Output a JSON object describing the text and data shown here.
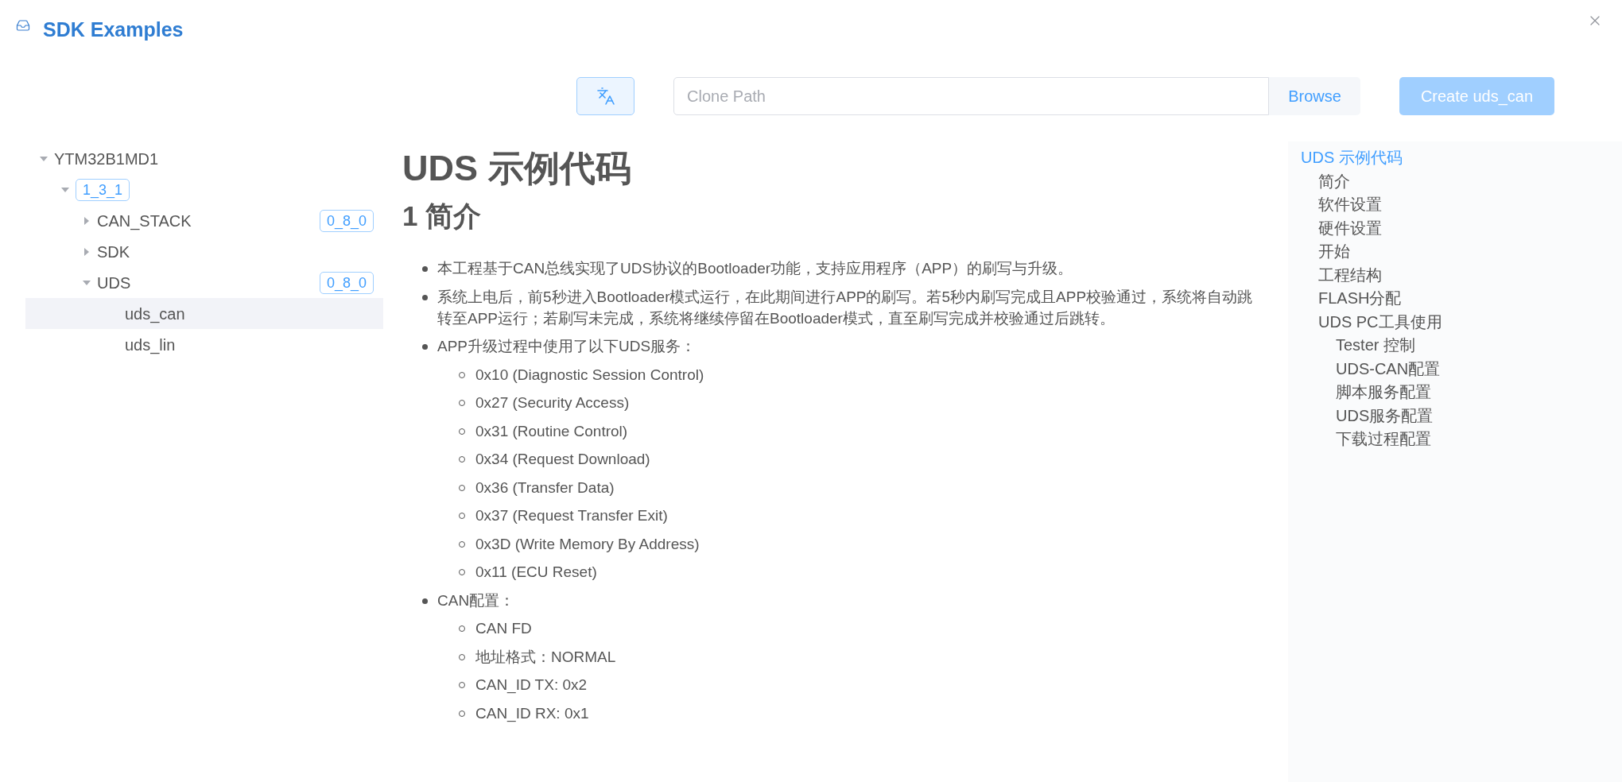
{
  "window": {
    "title": "SDK Examples"
  },
  "toolbar": {
    "clone_path": {
      "placeholder": "Clone Path"
    },
    "browse": "Browse",
    "create": {
      "label": "Create uds_can",
      "disabled": true
    }
  },
  "tree": [
    {
      "label": "YTM32B1MD1",
      "kind": "folder",
      "expanded": true,
      "selected": false,
      "children": [
        {
          "label": "1_3_1",
          "kind": "version",
          "expanded": true,
          "selected": false,
          "children": [
            {
              "label": "CAN_STACK",
              "kind": "folder",
              "expanded": false,
              "selected": false,
              "badge": "0_8_0"
            },
            {
              "label": "SDK",
              "kind": "folder",
              "expanded": false,
              "selected": false
            },
            {
              "label": "UDS",
              "kind": "folder",
              "expanded": true,
              "selected": false,
              "badge": "0_8_0",
              "children": [
                {
                  "label": "uds_can",
                  "kind": "leaf",
                  "selected": true
                },
                {
                  "label": "uds_lin",
                  "kind": "leaf",
                  "selected": false
                }
              ]
            }
          ]
        }
      ]
    }
  ],
  "doc": {
    "title": "UDS 示例代码",
    "section_heading": "1 简介",
    "bullets": [
      {
        "text": "本工程基于CAN总线实现了UDS协议的Bootloader功能，支持应用程序（APP）的刷写与升级。"
      },
      {
        "text": "系统上电后，前5秒进入Bootloader模式运行，在此期间进行APP的刷写。若5秒内刷写完成且APP校验通过，系统将自动跳转至APP运行；若刷写未完成，系统将继续停留在Bootloader模式，直至刷写完成并校验通过后跳转。"
      },
      {
        "text": "APP升级过程中使用了以下UDS服务：",
        "children": [
          "0x10 (Diagnostic Session Control)",
          "0x27 (Security Access)",
          "0x31 (Routine Control)",
          "0x34 (Request Download)",
          "0x36 (Transfer Data)",
          "0x37 (Request Transfer Exit)",
          "0x3D (Write Memory By Address)",
          "0x11 (ECU Reset)"
        ]
      },
      {
        "text": "CAN配置：",
        "children": [
          "CAN FD",
          "地址格式：NORMAL",
          "CAN_ID TX: 0x2",
          "CAN_ID RX: 0x1"
        ]
      }
    ]
  },
  "toc": [
    {
      "label": "UDS 示例代码",
      "selected": true,
      "children": [
        {
          "label": "简介",
          "selected": false
        },
        {
          "label": "软件设置",
          "selected": false
        },
        {
          "label": "硬件设置",
          "selected": false
        },
        {
          "label": "开始",
          "selected": false
        },
        {
          "label": "工程结构",
          "selected": false
        },
        {
          "label": "FLASH分配",
          "selected": false
        },
        {
          "label": "UDS PC工具使用",
          "selected": false,
          "children": [
            {
              "label": "Tester 控制",
              "selected": false
            },
            {
              "label": "UDS-CAN配置",
              "selected": false
            },
            {
              "label": "脚本服务配置",
              "selected": false
            },
            {
              "label": "UDS服务配置",
              "selected": false
            },
            {
              "label": "下载过程配置",
              "selected": false
            }
          ]
        }
      ]
    }
  ]
}
